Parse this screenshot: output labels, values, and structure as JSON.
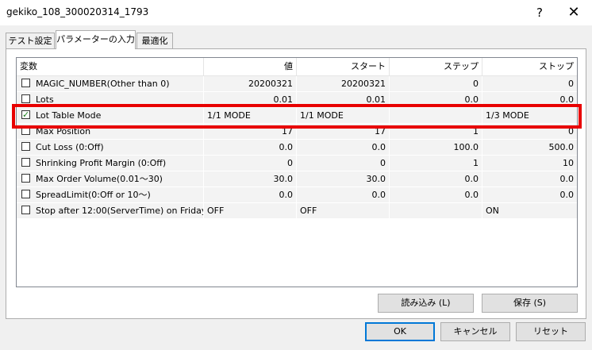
{
  "window": {
    "title": "gekiko_108_300020314_1793",
    "help_label": "?",
    "close_label": "✕"
  },
  "tabs": [
    {
      "label": "テスト設定"
    },
    {
      "label": "パラメーターの入力"
    },
    {
      "label": "最適化"
    }
  ],
  "table": {
    "headers": [
      "変数",
      "値",
      "スタート",
      "ステップ",
      "ストップ"
    ],
    "rows": [
      {
        "checked": false,
        "name": "MAGIC_NUMBER(Other than 0)",
        "value": "20200321",
        "start": "20200321",
        "step": "0",
        "stop": "0"
      },
      {
        "checked": false,
        "name": "Lots",
        "value": "0.01",
        "start": "0.01",
        "step": "0.0",
        "stop": "0.0"
      },
      {
        "checked": true,
        "name": "Lot Table Mode",
        "value": "1/1 MODE",
        "start": "1/1 MODE",
        "step": "",
        "stop": "1/3 MODE"
      },
      {
        "checked": false,
        "name": "Max Position",
        "value": "17",
        "start": "17",
        "step": "1",
        "stop": "0"
      },
      {
        "checked": false,
        "name": "Cut Loss (0:Off)",
        "value": "0.0",
        "start": "0.0",
        "step": "100.0",
        "stop": "500.0"
      },
      {
        "checked": false,
        "name": "Shrinking Profit Margin (0:Off)",
        "value": "0",
        "start": "0",
        "step": "1",
        "stop": "10"
      },
      {
        "checked": false,
        "name": "Max Order Volume(0.01～30)",
        "value": "30.0",
        "start": "30.0",
        "step": "0.0",
        "stop": "0.0"
      },
      {
        "checked": false,
        "name": "SpreadLimit(0:Off or 10～)",
        "value": "0.0",
        "start": "0.0",
        "step": "0.0",
        "stop": "0.0"
      },
      {
        "checked": false,
        "name": "Stop after 12:00(ServerTime) on Friday",
        "value": "OFF",
        "start": "OFF",
        "step": "",
        "stop": "ON"
      }
    ]
  },
  "buttons": {
    "load": "読み込み (L)",
    "save": "保存 (S)",
    "ok": "OK",
    "cancel": "キャンセル",
    "reset": "リセット"
  },
  "colors": {
    "highlight": "#e80000",
    "default_button_border": "#0078d7"
  }
}
